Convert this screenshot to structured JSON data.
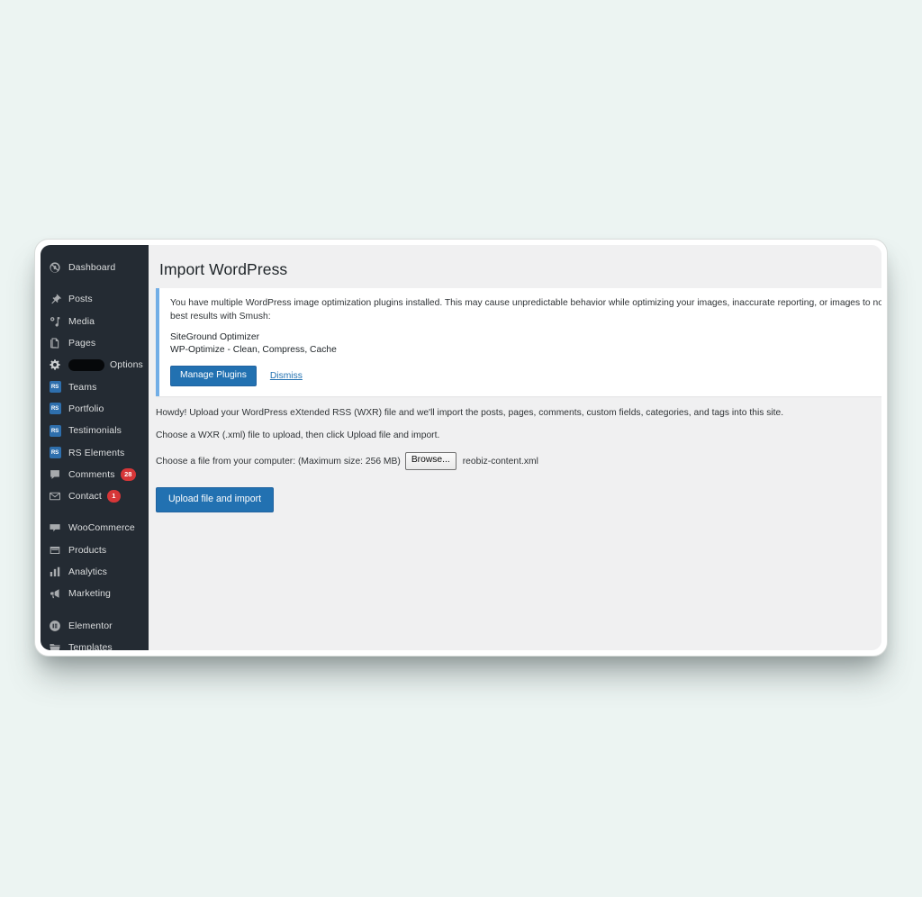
{
  "window": {
    "title": "Import WordPress"
  },
  "sidebar": {
    "items": [
      {
        "label": "Dashboard",
        "icon": "dashboard-icon",
        "badge": null,
        "gap_after": true
      },
      {
        "label": "Posts",
        "icon": "pin-icon",
        "badge": null,
        "gap_after": false
      },
      {
        "label": "Media",
        "icon": "media-icon",
        "badge": null,
        "gap_after": false
      },
      {
        "label": "Pages",
        "icon": "pages-icon",
        "badge": null,
        "gap_after": false
      },
      {
        "label": "Options",
        "icon": "gear-icon",
        "badge": null,
        "redacted": true,
        "gap_after": false
      },
      {
        "label": "Teams",
        "icon": "rs-icon",
        "badge": null,
        "gap_after": false
      },
      {
        "label": "Portfolio",
        "icon": "rs-icon",
        "badge": null,
        "gap_after": false
      },
      {
        "label": "Testimonials",
        "icon": "rs-icon",
        "badge": null,
        "gap_after": false
      },
      {
        "label": "RS Elements",
        "icon": "rs-icon",
        "badge": null,
        "gap_after": false
      },
      {
        "label": "Comments",
        "icon": "comment-icon",
        "badge": "28",
        "gap_after": false
      },
      {
        "label": "Contact",
        "icon": "envelope-icon",
        "badge": "1",
        "gap_after": true
      },
      {
        "label": "WooCommerce",
        "icon": "woocommerce-icon",
        "badge": null,
        "gap_after": false
      },
      {
        "label": "Products",
        "icon": "products-icon",
        "badge": null,
        "gap_after": false
      },
      {
        "label": "Analytics",
        "icon": "analytics-icon",
        "badge": null,
        "gap_after": false
      },
      {
        "label": "Marketing",
        "icon": "megaphone-icon",
        "badge": null,
        "gap_after": true
      },
      {
        "label": "Elementor",
        "icon": "elementor-icon",
        "badge": null,
        "gap_after": false
      },
      {
        "label": "Templates",
        "icon": "folder-icon",
        "badge": null,
        "gap_after": false
      }
    ],
    "rs_badge_text": "RS"
  },
  "notice": {
    "message": "You have multiple WordPress image optimization plugins installed. This may cause unpredictable behavior while optimizing your images, inaccurate reporting, or images to not display. For best results with Smush:",
    "plugins": [
      "SiteGround Optimizer",
      "WP-Optimize - Clean, Compress, Cache"
    ],
    "manage_label": "Manage Plugins",
    "dismiss_label": "Dismiss",
    "accent_color": "#72aee6",
    "button_color": "#2271b1"
  },
  "import": {
    "howdy": "Howdy! Upload your WordPress eXtended RSS (WXR) file and we'll import the posts, pages, comments, custom fields, categories, and tags into this site.",
    "instructions": "Choose a WXR (.xml) file to upload, then click Upload file and import.",
    "file_label": "Choose a file from your computer: (Maximum size: 256 MB)",
    "browse_label": "Browse...",
    "file_name": "reobiz-content.xml",
    "submit_label": "Upload file and import"
  }
}
